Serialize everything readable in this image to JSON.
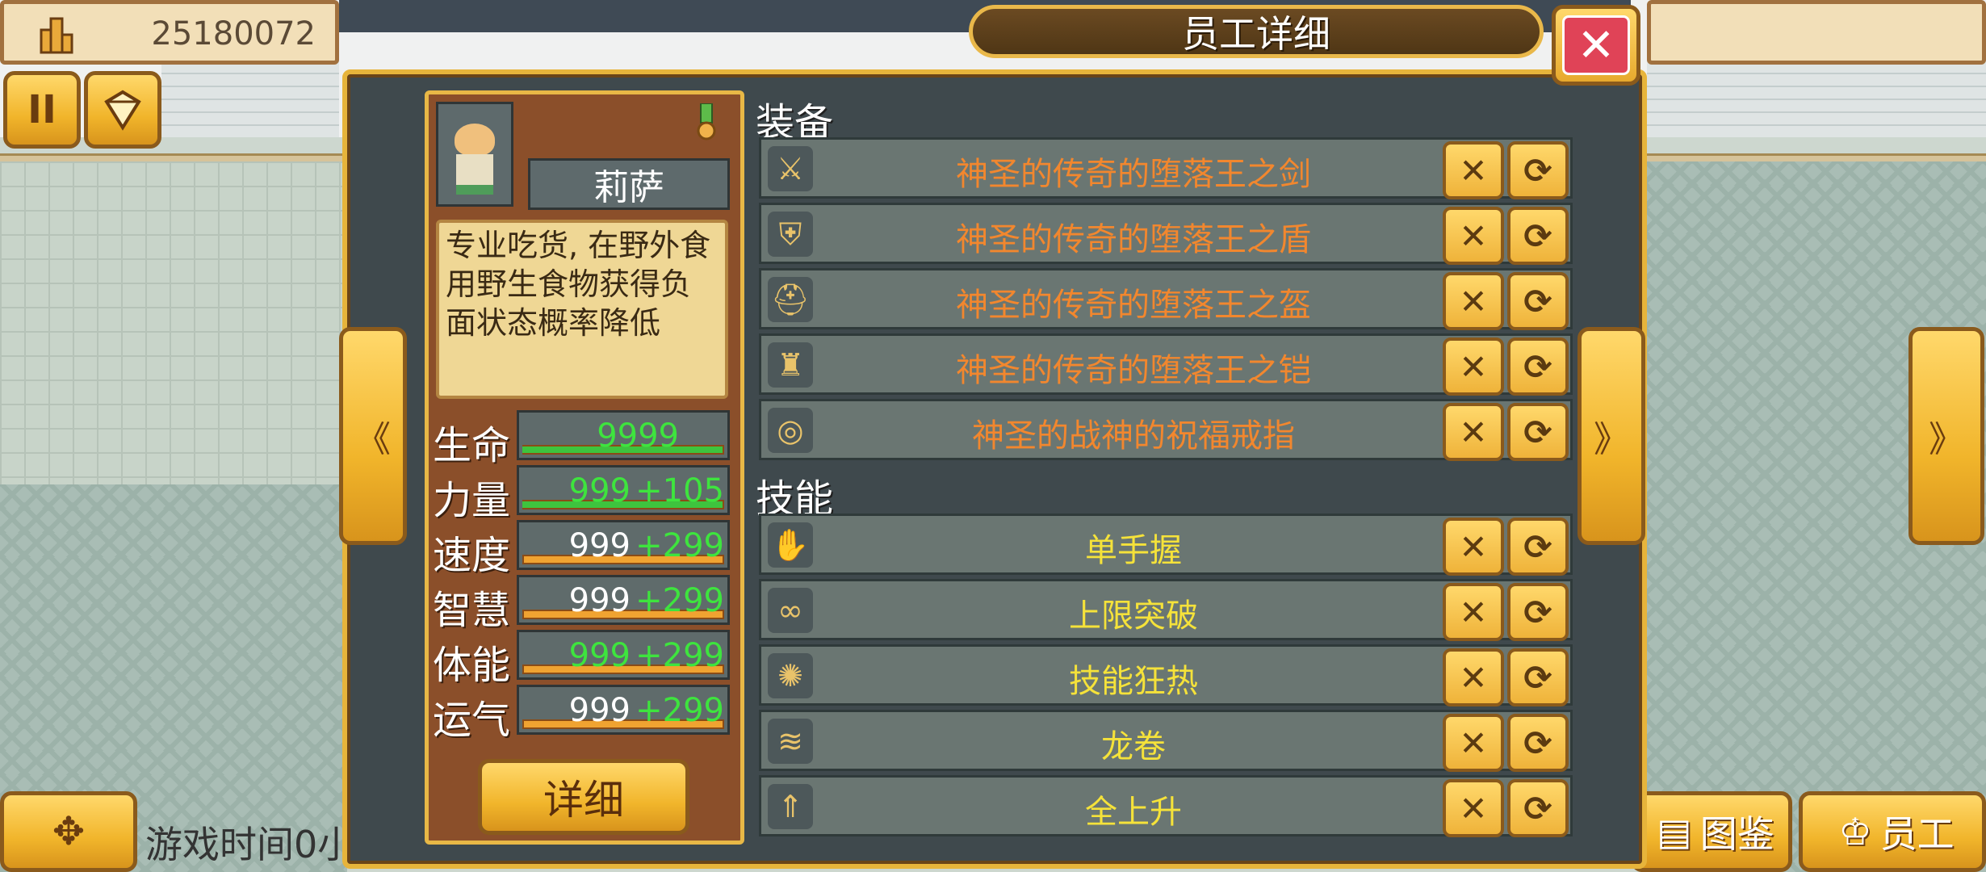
{
  "hud": {
    "money": "25180072",
    "pause_label": "II",
    "game_time_label": "游戏时间0小",
    "atlas_label": "图鉴",
    "staff_label": "员工"
  },
  "modal": {
    "title": "员工详细",
    "close_label": "✕",
    "prev_label": "《",
    "next_label": "》"
  },
  "employee": {
    "name": "莉萨",
    "description": "专业吃货, 在野外食用野生食物获得负面状态概率降低",
    "stats": [
      {
        "label": "生命",
        "base": "9999",
        "bonus": "",
        "fill": 1.0
      },
      {
        "label": "力量",
        "base": "999",
        "bonus": "+105",
        "fill": 1.0
      },
      {
        "label": "速度",
        "base": "999",
        "bonus": "+299",
        "fill": 0.0
      },
      {
        "label": "智慧",
        "base": "999",
        "bonus": "+299",
        "fill": 0.0
      },
      {
        "label": "体能",
        "base": "999",
        "bonus": "+299",
        "fill": 0.0
      },
      {
        "label": "运气",
        "base": "999",
        "bonus": "+299",
        "fill": 0.0
      }
    ],
    "detail_button": "详细"
  },
  "equipment": {
    "title": "装备",
    "items": [
      {
        "name": "神圣的传奇的堕落王之剑",
        "icon": "sword-icon"
      },
      {
        "name": "神圣的传奇的堕落王之盾",
        "icon": "shield-icon"
      },
      {
        "name": "神圣的传奇的堕落王之盔",
        "icon": "helmet-icon"
      },
      {
        "name": "神圣的传奇的堕落王之铠",
        "icon": "armor-icon"
      },
      {
        "name": "神圣的战神的祝福戒指",
        "icon": "ring-icon"
      }
    ]
  },
  "skills": {
    "title": "技能",
    "items": [
      {
        "name": "单手握",
        "icon": "hand-grip-icon"
      },
      {
        "name": "上限突破",
        "icon": "limit-break-icon"
      },
      {
        "name": "技能狂热",
        "icon": "skill-frenzy-icon"
      },
      {
        "name": "龙卷",
        "icon": "tornado-icon"
      },
      {
        "name": "全上升",
        "icon": "all-up-icon"
      }
    ]
  },
  "row_buttons": {
    "remove": "✕",
    "swap": "⟳"
  },
  "colors": {
    "equip_text": "#f2872e",
    "skill_text": "#f5e23a",
    "bonus_text": "#3ee43e",
    "close_red": "#e04357",
    "gold": "#f1b52b"
  }
}
